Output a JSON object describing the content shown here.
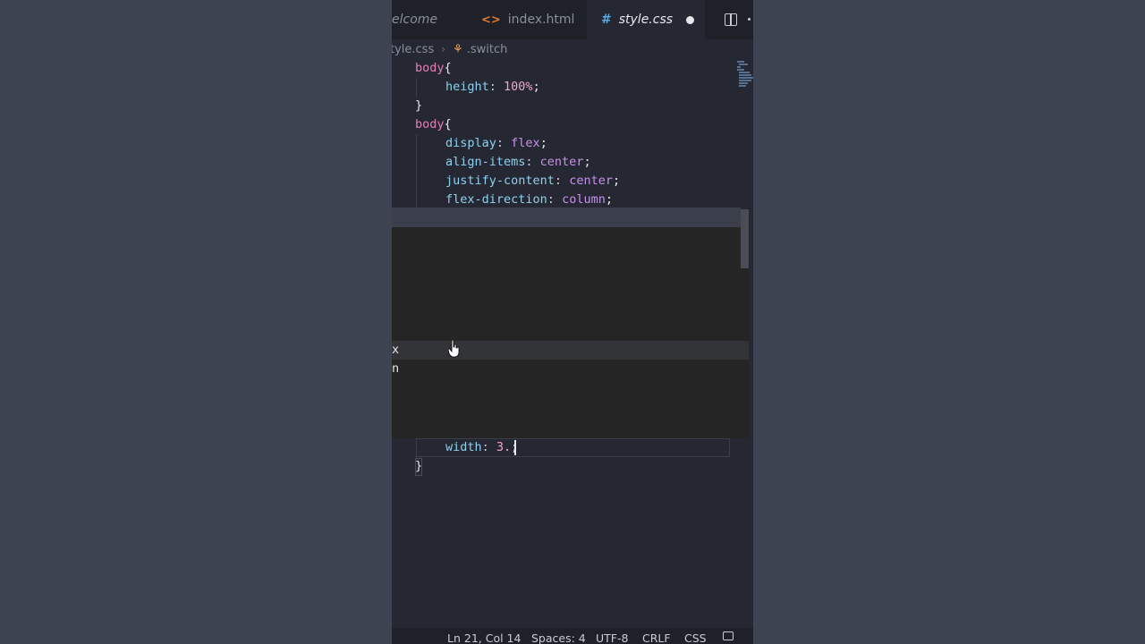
{
  "tabs": [
    {
      "label": "elcome",
      "active": false
    },
    {
      "label": "index.html",
      "icon": "html-file-icon",
      "active": false
    },
    {
      "label": "style.css",
      "icon": "css-file-icon",
      "active": true,
      "modified": true
    }
  ],
  "breadcrumb": {
    "file": "tyle.css",
    "symbol": ".switch"
  },
  "code_lines": {
    "l1_sel": "body",
    "l1_brace": "{",
    "l2_prop": "height",
    "l2_val": "100%",
    "l3_brace": "}",
    "l4_sel": "body",
    "l4_brace": "{",
    "l5_prop": "display",
    "l5_val": "flex",
    "l6_prop": "align-items",
    "l6_val": "center",
    "l7_prop": "justify-content",
    "l7_val": "center",
    "l8_prop": "flex-direction",
    "l8_val": "column",
    "l9_prop": "width",
    "l9_val": "3.",
    "l10_brace": "}"
  },
  "suggestion": {
    "item1": "x",
    "item2": "n"
  },
  "status": {
    "position": "Ln 21, Col 14",
    "spaces": "Spaces: 4",
    "encoding": "UTF-8",
    "eol": "CRLF",
    "language": "CSS"
  },
  "colors": {
    "background": "#3e4352",
    "editor": "#252833",
    "selector": "#e57fb8",
    "property": "#8fd0ee",
    "value": "#c792ea"
  }
}
